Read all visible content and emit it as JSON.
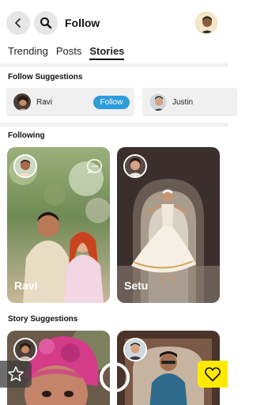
{
  "header": {
    "title": "Follow",
    "back_icon": "back-arrow-icon",
    "search_icon": "search-icon"
  },
  "tabs": [
    {
      "label": "Trending",
      "active": false
    },
    {
      "label": "Posts",
      "active": false
    },
    {
      "label": "Stories",
      "active": true
    }
  ],
  "follow_suggestions": {
    "title": "Follow Suggestions",
    "items": [
      {
        "name": "Ravi",
        "button": "Follow"
      },
      {
        "name": "Justin"
      }
    ]
  },
  "following": {
    "title": "Following",
    "stories": [
      {
        "name": "Ravi"
      },
      {
        "name": "Setu"
      }
    ]
  },
  "story_suggestions": {
    "title": "Story Suggestions"
  },
  "colors": {
    "accent": "#2d9cdb",
    "heart_button": "#ffea00"
  }
}
